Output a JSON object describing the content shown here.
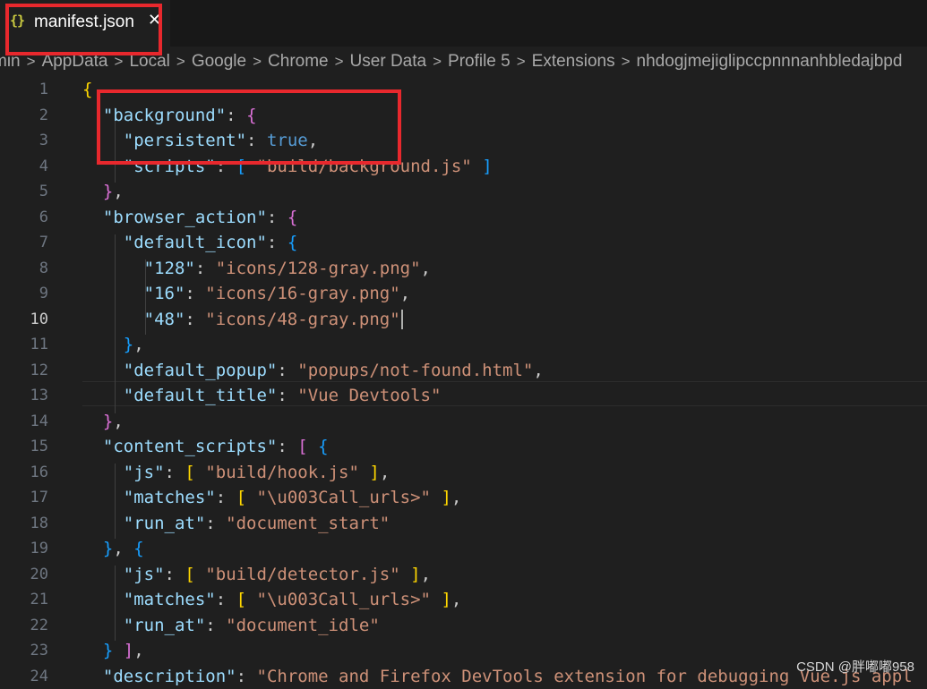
{
  "tab": {
    "icon": "{}",
    "icon_name": "json-file-icon",
    "label": "manifest.json",
    "close": "✕"
  },
  "breadcrumb": [
    "min",
    "AppData",
    "Local",
    "Google",
    "Chrome",
    "User Data",
    "Profile 5",
    "Extensions",
    "nhdogjmejiglipccpnnnanhbledajbpd"
  ],
  "breadcrumb_separator": ">",
  "active_line": 10,
  "lines": [
    {
      "n": "1",
      "t": [
        [
          "br1",
          "{"
        ]
      ]
    },
    {
      "n": "2",
      "t": [
        [
          "p",
          "  "
        ],
        [
          "k",
          "\"background\""
        ],
        [
          "p",
          ": "
        ],
        [
          "br2",
          "{"
        ]
      ]
    },
    {
      "n": "3",
      "t": [
        [
          "p",
          "    "
        ],
        [
          "k",
          "\"persistent\""
        ],
        [
          "p",
          ": "
        ],
        [
          "b",
          "true"
        ],
        [
          "p",
          ","
        ]
      ]
    },
    {
      "n": "4",
      "t": [
        [
          "p",
          "    "
        ],
        [
          "k",
          "\"scripts\""
        ],
        [
          "p",
          ": "
        ],
        [
          "br3",
          "["
        ],
        [
          "p",
          " "
        ],
        [
          "s",
          "\"build/background.js\""
        ],
        [
          "p",
          " "
        ],
        [
          "br3",
          "]"
        ]
      ]
    },
    {
      "n": "5",
      "t": [
        [
          "p",
          "  "
        ],
        [
          "br2",
          "}"
        ],
        [
          "p",
          ","
        ]
      ]
    },
    {
      "n": "6",
      "t": [
        [
          "p",
          "  "
        ],
        [
          "k",
          "\"browser_action\""
        ],
        [
          "p",
          ": "
        ],
        [
          "br2",
          "{"
        ]
      ]
    },
    {
      "n": "7",
      "t": [
        [
          "p",
          "    "
        ],
        [
          "k",
          "\"default_icon\""
        ],
        [
          "p",
          ": "
        ],
        [
          "br3",
          "{"
        ]
      ]
    },
    {
      "n": "8",
      "t": [
        [
          "p",
          "      "
        ],
        [
          "k",
          "\"128\""
        ],
        [
          "p",
          ": "
        ],
        [
          "s",
          "\"icons/128-gray.png\""
        ],
        [
          "p",
          ","
        ]
      ]
    },
    {
      "n": "9",
      "t": [
        [
          "p",
          "      "
        ],
        [
          "k",
          "\"16\""
        ],
        [
          "p",
          ": "
        ],
        [
          "s",
          "\"icons/16-gray.png\""
        ],
        [
          "p",
          ","
        ]
      ]
    },
    {
      "n": "10",
      "t": [
        [
          "p",
          "      "
        ],
        [
          "k",
          "\"48\""
        ],
        [
          "p",
          ": "
        ],
        [
          "s",
          "\"icons/48-gray.png\""
        ]
      ]
    },
    {
      "n": "11",
      "t": [
        [
          "p",
          "    "
        ],
        [
          "br3",
          "}"
        ],
        [
          "p",
          ","
        ]
      ]
    },
    {
      "n": "12",
      "t": [
        [
          "p",
          "    "
        ],
        [
          "k",
          "\"default_popup\""
        ],
        [
          "p",
          ": "
        ],
        [
          "s",
          "\"popups/not-found.html\""
        ],
        [
          "p",
          ","
        ]
      ]
    },
    {
      "n": "13",
      "t": [
        [
          "p",
          "    "
        ],
        [
          "k",
          "\"default_title\""
        ],
        [
          "p",
          ": "
        ],
        [
          "s",
          "\"Vue Devtools\""
        ]
      ]
    },
    {
      "n": "14",
      "t": [
        [
          "p",
          "  "
        ],
        [
          "br2",
          "}"
        ],
        [
          "p",
          ","
        ]
      ]
    },
    {
      "n": "15",
      "t": [
        [
          "p",
          "  "
        ],
        [
          "k",
          "\"content_scripts\""
        ],
        [
          "p",
          ": "
        ],
        [
          "br2",
          "["
        ],
        [
          "p",
          " "
        ],
        [
          "br3",
          "{"
        ]
      ]
    },
    {
      "n": "16",
      "t": [
        [
          "p",
          "    "
        ],
        [
          "k",
          "\"js\""
        ],
        [
          "p",
          ": "
        ],
        [
          "br1",
          "["
        ],
        [
          "p",
          " "
        ],
        [
          "s",
          "\"build/hook.js\""
        ],
        [
          "p",
          " "
        ],
        [
          "br1",
          "]"
        ],
        [
          "p",
          ","
        ]
      ]
    },
    {
      "n": "17",
      "t": [
        [
          "p",
          "    "
        ],
        [
          "k",
          "\"matches\""
        ],
        [
          "p",
          ": "
        ],
        [
          "br1",
          "["
        ],
        [
          "p",
          " "
        ],
        [
          "s",
          "\"\\u003Call_urls>\""
        ],
        [
          "p",
          " "
        ],
        [
          "br1",
          "]"
        ],
        [
          "p",
          ","
        ]
      ]
    },
    {
      "n": "18",
      "t": [
        [
          "p",
          "    "
        ],
        [
          "k",
          "\"run_at\""
        ],
        [
          "p",
          ": "
        ],
        [
          "s",
          "\"document_start\""
        ]
      ]
    },
    {
      "n": "19",
      "t": [
        [
          "p",
          "  "
        ],
        [
          "br3",
          "}"
        ],
        [
          "p",
          ", "
        ],
        [
          "br3",
          "{"
        ]
      ]
    },
    {
      "n": "20",
      "t": [
        [
          "p",
          "    "
        ],
        [
          "k",
          "\"js\""
        ],
        [
          "p",
          ": "
        ],
        [
          "br1",
          "["
        ],
        [
          "p",
          " "
        ],
        [
          "s",
          "\"build/detector.js\""
        ],
        [
          "p",
          " "
        ],
        [
          "br1",
          "]"
        ],
        [
          "p",
          ","
        ]
      ]
    },
    {
      "n": "21",
      "t": [
        [
          "p",
          "    "
        ],
        [
          "k",
          "\"matches\""
        ],
        [
          "p",
          ": "
        ],
        [
          "br1",
          "["
        ],
        [
          "p",
          " "
        ],
        [
          "s",
          "\"\\u003Call_urls>\""
        ],
        [
          "p",
          " "
        ],
        [
          "br1",
          "]"
        ],
        [
          "p",
          ","
        ]
      ]
    },
    {
      "n": "22",
      "t": [
        [
          "p",
          "    "
        ],
        [
          "k",
          "\"run_at\""
        ],
        [
          "p",
          ": "
        ],
        [
          "s",
          "\"document_idle\""
        ]
      ]
    },
    {
      "n": "23",
      "t": [
        [
          "p",
          "  "
        ],
        [
          "br3",
          "}"
        ],
        [
          "p",
          " "
        ],
        [
          "br2",
          "]"
        ],
        [
          "p",
          ","
        ]
      ]
    },
    {
      "n": "24",
      "t": [
        [
          "p",
          "  "
        ],
        [
          "k",
          "\"description\""
        ],
        [
          "p",
          ": "
        ],
        [
          "s",
          "\"Chrome and Firefox DevTools extension for debugging Vue.js appl"
        ]
      ]
    }
  ],
  "watermark": "CSDN @胖嘟嘟958",
  "colors": {
    "annotation_red": "#e8282d",
    "json_key": "#9cdcfe",
    "json_string": "#ce9178",
    "json_boolean": "#569cd6"
  }
}
